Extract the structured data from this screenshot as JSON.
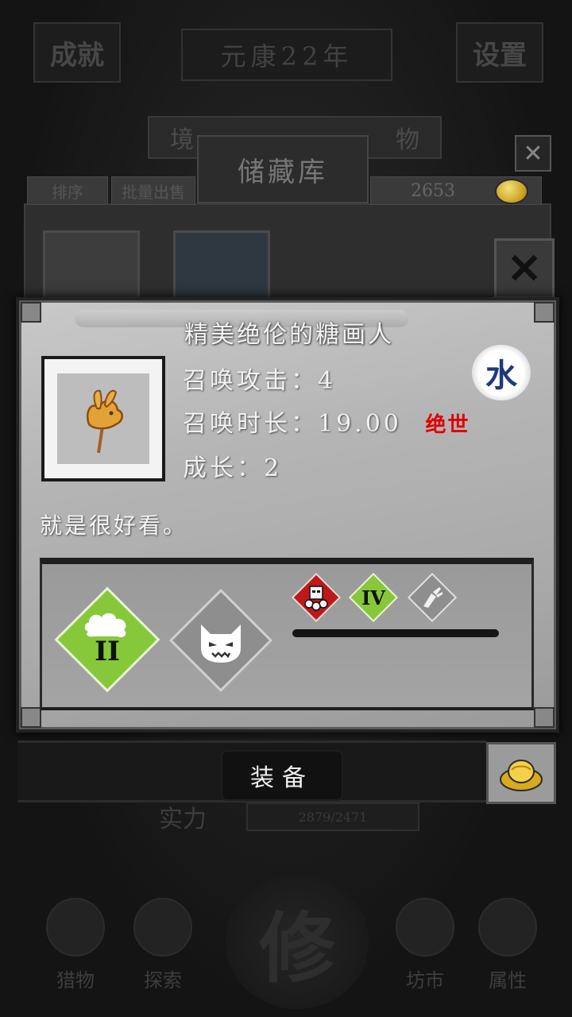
{
  "background": {
    "top_left_button": "成就",
    "top_title": "元康22年",
    "top_right_button": "设置",
    "storage_tab_left": "境",
    "storage_tab_right": "物",
    "storage_title": "储藏库",
    "sort_label": "排序",
    "bulk_sell_label": "批量出售",
    "coins": "2653",
    "power_label": "实力",
    "power_value": "2879/2471",
    "nav": [
      {
        "label": "猎物"
      },
      {
        "label": "探索"
      },
      {
        "label": "坊市"
      },
      {
        "label": "属性"
      }
    ],
    "center_emblem": "修"
  },
  "item": {
    "name": "精美绝伦的糖画人",
    "stats": {
      "summon_attack_label": "召唤攻击",
      "summon_attack_value": "4",
      "summon_duration_label": "召唤时长",
      "summon_duration_value": "19.00",
      "growth_label": "成长",
      "growth_value": "2",
      "separator": "："
    },
    "rarity": "绝世",
    "element": "水",
    "description": "就是很好看。",
    "skills": {
      "main_level": "II",
      "small_level": "IV"
    }
  },
  "actions": {
    "equip_label": "装备"
  },
  "colors": {
    "rarity": "#e00000",
    "element": "#1d3a7a",
    "skill_green": "#86c83a",
    "skill_red": "#c01818",
    "skill_gray": "#8e8e8e"
  }
}
